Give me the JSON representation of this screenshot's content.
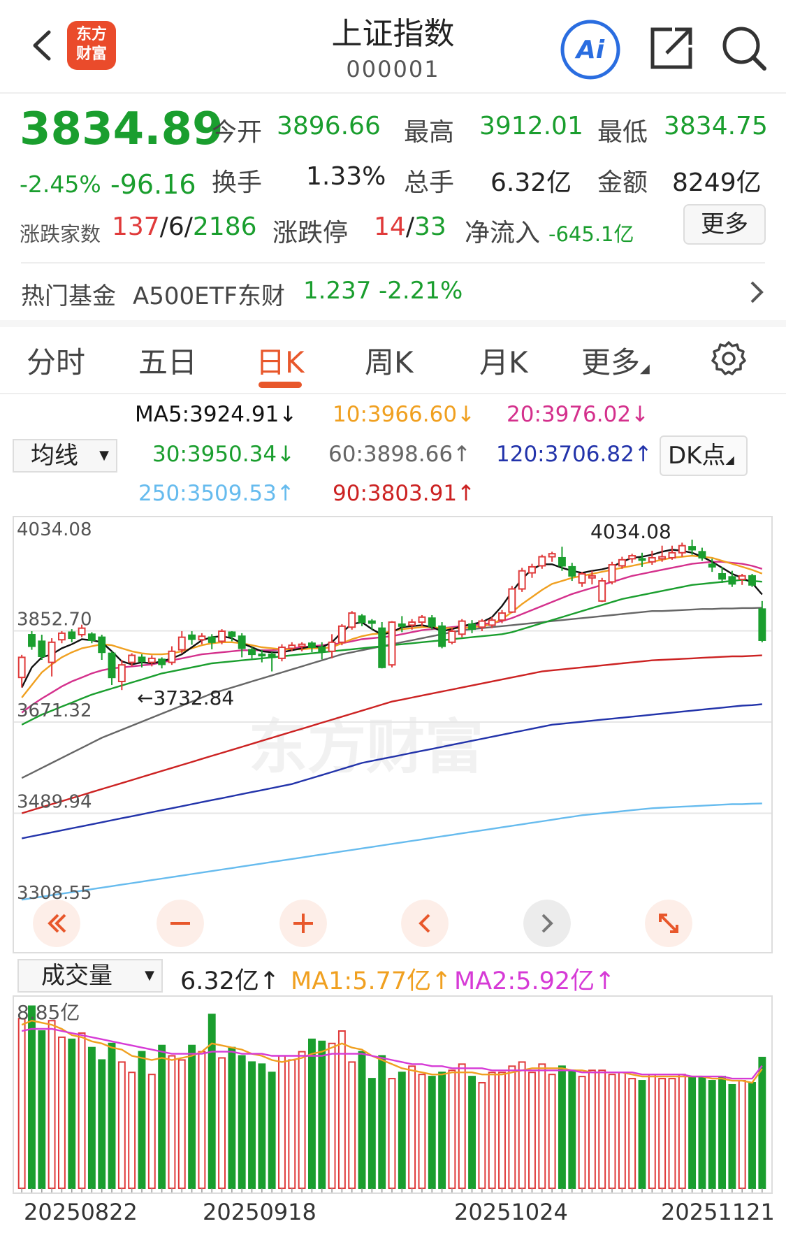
{
  "header": {
    "title": "上证指数",
    "code": "000001",
    "logo_text_line1": "东方",
    "logo_text_line2": "财富"
  },
  "quote": {
    "price": "3834.89",
    "change_pct": "-2.45%",
    "change": "-96.16",
    "open_label": "今开",
    "open": "3896.66",
    "high_label": "最高",
    "high": "3912.01",
    "low_label": "最低",
    "low": "3834.75",
    "turnover_label": "换手",
    "turnover": "1.33%",
    "volume_label": "总手",
    "volume": "6.32亿",
    "amount_label": "金额",
    "amount": "8249亿",
    "breadth_label": "涨跌家数",
    "breadth_up": "137",
    "breadth_flat": "6",
    "breadth_down": "2186",
    "limit_label": "涨跌停",
    "limit_up": "14",
    "limit_down": "33",
    "netflow_label": "净流入",
    "netflow": "-645.1亿",
    "more_label": "更多"
  },
  "fund": {
    "label": "热门基金",
    "name": "A500ETF东财",
    "price": "1.237",
    "change": "-2.21%"
  },
  "tabs": [
    "分时",
    "五日",
    "日K",
    "周K",
    "月K",
    "更多"
  ],
  "active_tab": "日K",
  "ma_legend": {
    "select_label": "均线",
    "ma5": "MA5:3924.91↓",
    "ma10": "10:3966.60↓",
    "ma20": "20:3976.02↓",
    "ma30": "30:3950.34↓",
    "ma60": "60:3898.66↑",
    "ma120": "120:3706.82↑",
    "ma250": "250:3509.53↑",
    "ma90": "90:3803.91↑",
    "dk_label": "DK点"
  },
  "price_axis": [
    "4034.08",
    "3852.70",
    "3671.32",
    "3489.94",
    "3308.55"
  ],
  "annotations": {
    "high": "4034.08",
    "low": "←3732.84"
  },
  "watermark": "东方财富",
  "volume_legend": {
    "select_label": "成交量",
    "vol": "6.32亿↑",
    "ma1": "MA1:5.77亿↑",
    "ma2": "MA2:5.92亿↑",
    "axis_top": "8.85亿"
  },
  "dates": [
    "20250822",
    "20250918",
    "20251024",
    "20251121"
  ],
  "colors": {
    "up": "#e03a3a",
    "down": "#1a9e2e",
    "ma5": "#111111",
    "ma10": "#f0a020",
    "ma20": "#d4308c",
    "ma30": "#1a9e2e",
    "ma60": "#666666",
    "ma90": "#cc2222",
    "ma120": "#2233aa",
    "ma250": "#66bbee",
    "accent": "#e8572b"
  },
  "chart_data": {
    "type": "candlestick",
    "ylim": [
      3308.55,
      4034.08
    ],
    "candles": [
      [
        3760,
        3800,
        3740,
        3805
      ],
      [
        3845,
        3822,
        3815,
        3852
      ],
      [
        3832,
        3802,
        3795,
        3845
      ],
      [
        3790,
        3830,
        3762,
        3838
      ],
      [
        3835,
        3848,
        3828,
        3852
      ],
      [
        3850,
        3838,
        3830,
        3856
      ],
      [
        3845,
        3858,
        3840,
        3865
      ],
      [
        3846,
        3834,
        3828,
        3850
      ],
      [
        3840,
        3810,
        3795,
        3845
      ],
      [
        3808,
        3760,
        3745,
        3812
      ],
      [
        3752,
        3785,
        3735,
        3795
      ],
      [
        3790,
        3804,
        3782,
        3808
      ],
      [
        3800,
        3792,
        3780,
        3806
      ],
      [
        3790,
        3798,
        3782,
        3804
      ],
      [
        3796,
        3786,
        3778,
        3800
      ],
      [
        3790,
        3812,
        3785,
        3822
      ],
      [
        3815,
        3840,
        3808,
        3852
      ],
      [
        3844,
        3836,
        3825,
        3852
      ],
      [
        3835,
        3842,
        3826,
        3848
      ],
      [
        3840,
        3830,
        3816,
        3846
      ],
      [
        3832,
        3852,
        3826,
        3856
      ],
      [
        3850,
        3842,
        3832,
        3852
      ],
      [
        3842,
        3818,
        3800,
        3848
      ],
      [
        3815,
        3806,
        3798,
        3820
      ],
      [
        3806,
        3804,
        3790,
        3815
      ],
      [
        3806,
        3800,
        3772,
        3810
      ],
      [
        3798,
        3820,
        3792,
        3826
      ],
      [
        3818,
        3824,
        3812,
        3830
      ],
      [
        3822,
        3826,
        3812,
        3830
      ],
      [
        3828,
        3820,
        3810,
        3832
      ],
      [
        3820,
        3812,
        3796,
        3830
      ],
      [
        3812,
        3830,
        3798,
        3846
      ],
      [
        3830,
        3862,
        3824,
        3866
      ],
      [
        3860,
        3888,
        3855,
        3892
      ],
      [
        3882,
        3870,
        3862,
        3886
      ],
      [
        3872,
        3868,
        3855,
        3876
      ],
      [
        3858,
        3780,
        3778,
        3870
      ],
      [
        3785,
        3870,
        3780,
        3872
      ],
      [
        3866,
        3862,
        3850,
        3882
      ],
      [
        3864,
        3870,
        3855,
        3876
      ],
      [
        3870,
        3880,
        3862,
        3884
      ],
      [
        3878,
        3862,
        3855,
        3884
      ],
      [
        3862,
        3822,
        3818,
        3870
      ],
      [
        3830,
        3852,
        3826,
        3858
      ],
      [
        3846,
        3872,
        3840,
        3876
      ],
      [
        3866,
        3856,
        3848,
        3874
      ],
      [
        3860,
        3872,
        3852,
        3876
      ],
      [
        3864,
        3874,
        3858,
        3880
      ],
      [
        3874,
        3888,
        3868,
        3894
      ],
      [
        3890,
        3936,
        3888,
        3942
      ],
      [
        3936,
        3972,
        3930,
        3978
      ],
      [
        3968,
        3980,
        3958,
        3986
      ],
      [
        3982,
        4000,
        3976,
        4004
      ],
      [
        4000,
        4006,
        3990,
        4010
      ],
      [
        3998,
        3982,
        3972,
        4020
      ],
      [
        3980,
        3962,
        3952,
        3988
      ],
      [
        3948,
        3966,
        3940,
        3970
      ],
      [
        3958,
        3962,
        3945,
        3972
      ],
      [
        3912,
        3952,
        3910,
        3958
      ],
      [
        3950,
        3984,
        3945,
        3990
      ],
      [
        3982,
        3994,
        3976,
        4000
      ],
      [
        3996,
        4002,
        3988,
        4006
      ],
      [
        3996,
        3994,
        3980,
        4008
      ],
      [
        3990,
        3998,
        3984,
        4012
      ],
      [
        3996,
        4000,
        3990,
        4022
      ],
      [
        3998,
        4008,
        3994,
        4022
      ],
      [
        4008,
        4022,
        4000,
        4028
      ],
      [
        4020,
        4014,
        4004,
        4034
      ],
      [
        4010,
        3998,
        3992,
        4018
      ],
      [
        3985,
        3980,
        3970,
        3996
      ],
      [
        3966,
        3956,
        3948,
        3980
      ],
      [
        3960,
        3946,
        3940,
        3972
      ],
      [
        3955,
        3962,
        3944,
        3966
      ],
      [
        3962,
        3944,
        3940,
        3966
      ],
      [
        3896,
        3834,
        3830,
        3912
      ]
    ],
    "ma_series": {
      "ma5": [
        3740,
        3780,
        3800,
        3806,
        3818,
        3826,
        3836,
        3834,
        3830,
        3812,
        3792,
        3786,
        3790,
        3788,
        3792,
        3798,
        3806,
        3820,
        3834,
        3840,
        3842,
        3838,
        3828,
        3820,
        3812,
        3810,
        3810,
        3814,
        3818,
        3822,
        3820,
        3830,
        3850,
        3866,
        3870,
        3856,
        3845,
        3850,
        3860,
        3862,
        3864,
        3860,
        3852,
        3856,
        3862,
        3866,
        3870,
        3880,
        3902,
        3930,
        3956,
        3975,
        3985,
        3985,
        3978,
        3972,
        3968,
        3972,
        3975,
        3980,
        3990,
        3998,
        4000,
        4004,
        4010,
        4014,
        4012,
        4008,
        4000,
        3990,
        3978,
        3966,
        3958,
        3948,
        3924.91
      ],
      "ma10": [
        3720,
        3745,
        3770,
        3786,
        3800,
        3810,
        3818,
        3822,
        3826,
        3824,
        3818,
        3812,
        3808,
        3806,
        3806,
        3808,
        3812,
        3818,
        3824,
        3828,
        3830,
        3830,
        3828,
        3824,
        3820,
        3818,
        3816,
        3816,
        3816,
        3818,
        3818,
        3820,
        3828,
        3836,
        3842,
        3846,
        3848,
        3852,
        3856,
        3858,
        3860,
        3860,
        3858,
        3858,
        3858,
        3860,
        3862,
        3866,
        3876,
        3890,
        3906,
        3920,
        3934,
        3946,
        3952,
        3958,
        3962,
        3966,
        3970,
        3974,
        3978,
        3982,
        3986,
        3990,
        3994,
        3998,
        4000,
        4002,
        4000,
        3998,
        3992,
        3986,
        3980,
        3974,
        3966.6
      ],
      "ma20": [
        3690,
        3705,
        3718,
        3730,
        3742,
        3752,
        3760,
        3768,
        3774,
        3778,
        3780,
        3782,
        3784,
        3786,
        3790,
        3794,
        3798,
        3802,
        3806,
        3808,
        3810,
        3812,
        3814,
        3814,
        3814,
        3814,
        3816,
        3818,
        3820,
        3822,
        3824,
        3826,
        3828,
        3832,
        3836,
        3838,
        3840,
        3842,
        3846,
        3850,
        3854,
        3856,
        3858,
        3860,
        3862,
        3864,
        3866,
        3868,
        3872,
        3878,
        3886,
        3894,
        3902,
        3910,
        3918,
        3926,
        3932,
        3938,
        3944,
        3950,
        3956,
        3962,
        3966,
        3970,
        3974,
        3978,
        3982,
        3986,
        3988,
        3990,
        3990,
        3988,
        3986,
        3982,
        3976.02
      ],
      "ma30": [
        3666,
        3676,
        3686,
        3694,
        3702,
        3710,
        3718,
        3726,
        3732,
        3738,
        3744,
        3750,
        3756,
        3762,
        3768,
        3772,
        3776,
        3780,
        3784,
        3788,
        3790,
        3792,
        3794,
        3796,
        3798,
        3800,
        3802,
        3804,
        3806,
        3808,
        3810,
        3812,
        3814,
        3816,
        3818,
        3820,
        3822,
        3824,
        3826,
        3828,
        3830,
        3832,
        3834,
        3836,
        3838,
        3840,
        3842,
        3844,
        3846,
        3850,
        3856,
        3862,
        3868,
        3874,
        3880,
        3886,
        3892,
        3898,
        3904,
        3910,
        3916,
        3920,
        3924,
        3928,
        3932,
        3936,
        3940,
        3944,
        3946,
        3948,
        3950,
        3952,
        3954,
        3952,
        3950.34
      ],
      "ma60": [
        3560,
        3570,
        3580,
        3590,
        3600,
        3610,
        3620,
        3630,
        3640,
        3648,
        3656,
        3664,
        3672,
        3680,
        3688,
        3696,
        3704,
        3712,
        3720,
        3728,
        3734,
        3740,
        3746,
        3752,
        3758,
        3764,
        3770,
        3776,
        3782,
        3788,
        3794,
        3800,
        3806,
        3810,
        3814,
        3818,
        3822,
        3826,
        3830,
        3834,
        3838,
        3842,
        3846,
        3850,
        3854,
        3856,
        3858,
        3860,
        3862,
        3864,
        3866,
        3868,
        3870,
        3872,
        3874,
        3876,
        3878,
        3880,
        3882,
        3884,
        3886,
        3888,
        3890,
        3892,
        3892,
        3893,
        3894,
        3895,
        3896,
        3896,
        3897,
        3897,
        3898,
        3898,
        3898.66
      ],
      "ma90": [
        3490,
        3496,
        3502,
        3508,
        3514,
        3520,
        3526,
        3532,
        3538,
        3544,
        3550,
        3556,
        3562,
        3568,
        3574,
        3580,
        3586,
        3592,
        3598,
        3604,
        3610,
        3616,
        3622,
        3628,
        3634,
        3640,
        3646,
        3652,
        3658,
        3664,
        3670,
        3676,
        3682,
        3688,
        3694,
        3700,
        3706,
        3712,
        3716,
        3720,
        3724,
        3728,
        3732,
        3736,
        3740,
        3744,
        3748,
        3752,
        3756,
        3760,
        3764,
        3768,
        3772,
        3774,
        3776,
        3778,
        3780,
        3782,
        3784,
        3786,
        3788,
        3790,
        3792,
        3794,
        3795,
        3796,
        3797,
        3798,
        3799,
        3800,
        3801,
        3802,
        3802,
        3803,
        3803.91
      ],
      "ma120": [
        3440,
        3444,
        3448,
        3452,
        3456,
        3460,
        3464,
        3468,
        3472,
        3476,
        3480,
        3484,
        3488,
        3492,
        3496,
        3500,
        3504,
        3508,
        3512,
        3516,
        3520,
        3524,
        3528,
        3532,
        3536,
        3540,
        3544,
        3548,
        3554,
        3560,
        3566,
        3572,
        3578,
        3584,
        3590,
        3594,
        3598,
        3602,
        3606,
        3610,
        3614,
        3618,
        3622,
        3626,
        3630,
        3634,
        3638,
        3642,
        3646,
        3650,
        3654,
        3658,
        3662,
        3666,
        3668,
        3670,
        3672,
        3674,
        3676,
        3678,
        3680,
        3682,
        3684,
        3686,
        3688,
        3690,
        3692,
        3694,
        3696,
        3698,
        3700,
        3702,
        3704,
        3705,
        3706.82
      ],
      "ma250": [
        3318,
        3321,
        3324,
        3327,
        3330,
        3333,
        3336,
        3339,
        3342,
        3345,
        3348,
        3351,
        3354,
        3357,
        3360,
        3363,
        3366,
        3369,
        3372,
        3375,
        3378,
        3381,
        3384,
        3387,
        3390,
        3393,
        3396,
        3399,
        3402,
        3405,
        3408,
        3411,
        3414,
        3417,
        3420,
        3423,
        3426,
        3429,
        3432,
        3435,
        3438,
        3441,
        3444,
        3447,
        3450,
        3453,
        3456,
        3459,
        3462,
        3465,
        3468,
        3471,
        3474,
        3477,
        3480,
        3483,
        3486,
        3488,
        3490,
        3492,
        3494,
        3496,
        3498,
        3500,
        3501,
        3502,
        3503,
        3504,
        3505,
        3506,
        3507,
        3508,
        3508,
        3509,
        3509.53
      ]
    },
    "volume": {
      "ylim": [
        0,
        8.85
      ],
      "values": [
        8.2,
        8.8,
        7.6,
        8.1,
        7.3,
        7.2,
        7.5,
        6.8,
        6.2,
        7.0,
        6.1,
        5.6,
        6.6,
        5.5,
        6.9,
        6.4,
        6.2,
        6.9,
        6.6,
        8.4,
        6.3,
        6.8,
        6.4,
        6.1,
        6.0,
        5.6,
        6.4,
        6.2,
        6.6,
        7.2,
        7.1,
        7.0,
        7.6,
        6.1,
        6.6,
        5.3,
        6.4,
        5.3,
        5.6,
        5.9,
        5.5,
        5.4,
        5.6,
        5.7,
        6.0,
        5.4,
        5.1,
        5.6,
        5.6,
        5.9,
        6.1,
        5.6,
        6.0,
        5.5,
        5.9,
        5.7,
        5.4,
        5.7,
        5.7,
        5.5,
        5.6,
        5.3,
        5.2,
        5.5,
        5.3,
        5.3,
        5.5,
        5.4,
        5.4,
        5.2,
        5.4,
        5.0,
        5.2,
        5.1,
        6.32
      ],
      "ma1": [
        7.9,
        8.1,
        8.0,
        7.9,
        7.7,
        7.4,
        7.3,
        7.1,
        7.0,
        6.8,
        6.7,
        6.4,
        6.3,
        6.2,
        6.3,
        6.2,
        6.3,
        6.4,
        6.6,
        7.0,
        6.9,
        6.8,
        6.7,
        6.5,
        6.4,
        6.2,
        6.1,
        6.2,
        6.3,
        6.5,
        6.6,
        6.8,
        7.0,
        6.8,
        6.7,
        6.4,
        6.2,
        6.0,
        5.8,
        5.7,
        5.6,
        5.5,
        5.5,
        5.6,
        5.6,
        5.6,
        5.5,
        5.5,
        5.5,
        5.6,
        5.7,
        5.8,
        5.8,
        5.8,
        5.8,
        5.7,
        5.7,
        5.6,
        5.6,
        5.6,
        5.6,
        5.5,
        5.4,
        5.4,
        5.4,
        5.4,
        5.4,
        5.4,
        5.4,
        5.3,
        5.3,
        5.2,
        5.2,
        5.1,
        5.77
      ],
      "ma2": [
        7.6,
        7.7,
        7.7,
        7.7,
        7.6,
        7.5,
        7.4,
        7.3,
        7.2,
        7.1,
        7.0,
        6.9,
        6.8,
        6.7,
        6.6,
        6.5,
        6.5,
        6.5,
        6.5,
        6.6,
        6.6,
        6.6,
        6.5,
        6.5,
        6.5,
        6.4,
        6.4,
        6.4,
        6.4,
        6.4,
        6.4,
        6.5,
        6.5,
        6.5,
        6.5,
        6.4,
        6.3,
        6.2,
        6.1,
        6.0,
        6.0,
        5.9,
        5.9,
        5.8,
        5.8,
        5.8,
        5.8,
        5.7,
        5.7,
        5.7,
        5.7,
        5.7,
        5.7,
        5.7,
        5.7,
        5.7,
        5.6,
        5.6,
        5.6,
        5.6,
        5.6,
        5.6,
        5.5,
        5.5,
        5.5,
        5.5,
        5.5,
        5.4,
        5.4,
        5.4,
        5.4,
        5.3,
        5.3,
        5.3,
        5.92
      ]
    }
  }
}
